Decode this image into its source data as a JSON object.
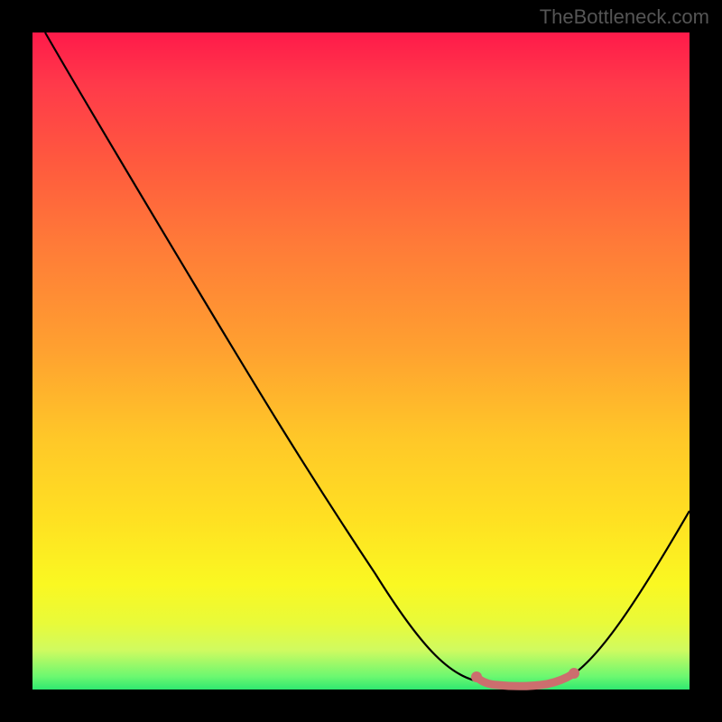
{
  "watermark": "TheBottleneck.com",
  "chart_data": {
    "type": "line",
    "title": "",
    "xlabel": "",
    "ylabel": "",
    "x_range": [
      0,
      100
    ],
    "y_range": [
      0,
      100
    ],
    "series": [
      {
        "name": "curve",
        "x": [
          2,
          10,
          20,
          30,
          40,
          50,
          60,
          66,
          70,
          74,
          78,
          82,
          88,
          94,
          100
        ],
        "y": [
          100,
          88,
          74,
          60,
          46,
          32,
          18,
          8,
          4,
          2,
          2,
          2,
          6,
          15,
          28
        ]
      }
    ],
    "flat_region": {
      "x_start": 68,
      "x_end": 84,
      "y": 2,
      "color": "#d07878"
    },
    "gradient_stops": [
      {
        "pos": 0,
        "color": "#ff1a4a"
      },
      {
        "pos": 20,
        "color": "#ff5a3e"
      },
      {
        "pos": 48,
        "color": "#ffa030"
      },
      {
        "pos": 74,
        "color": "#ffe022"
      },
      {
        "pos": 94,
        "color": "#d0fa60"
      },
      {
        "pos": 100,
        "color": "#30e870"
      }
    ]
  }
}
